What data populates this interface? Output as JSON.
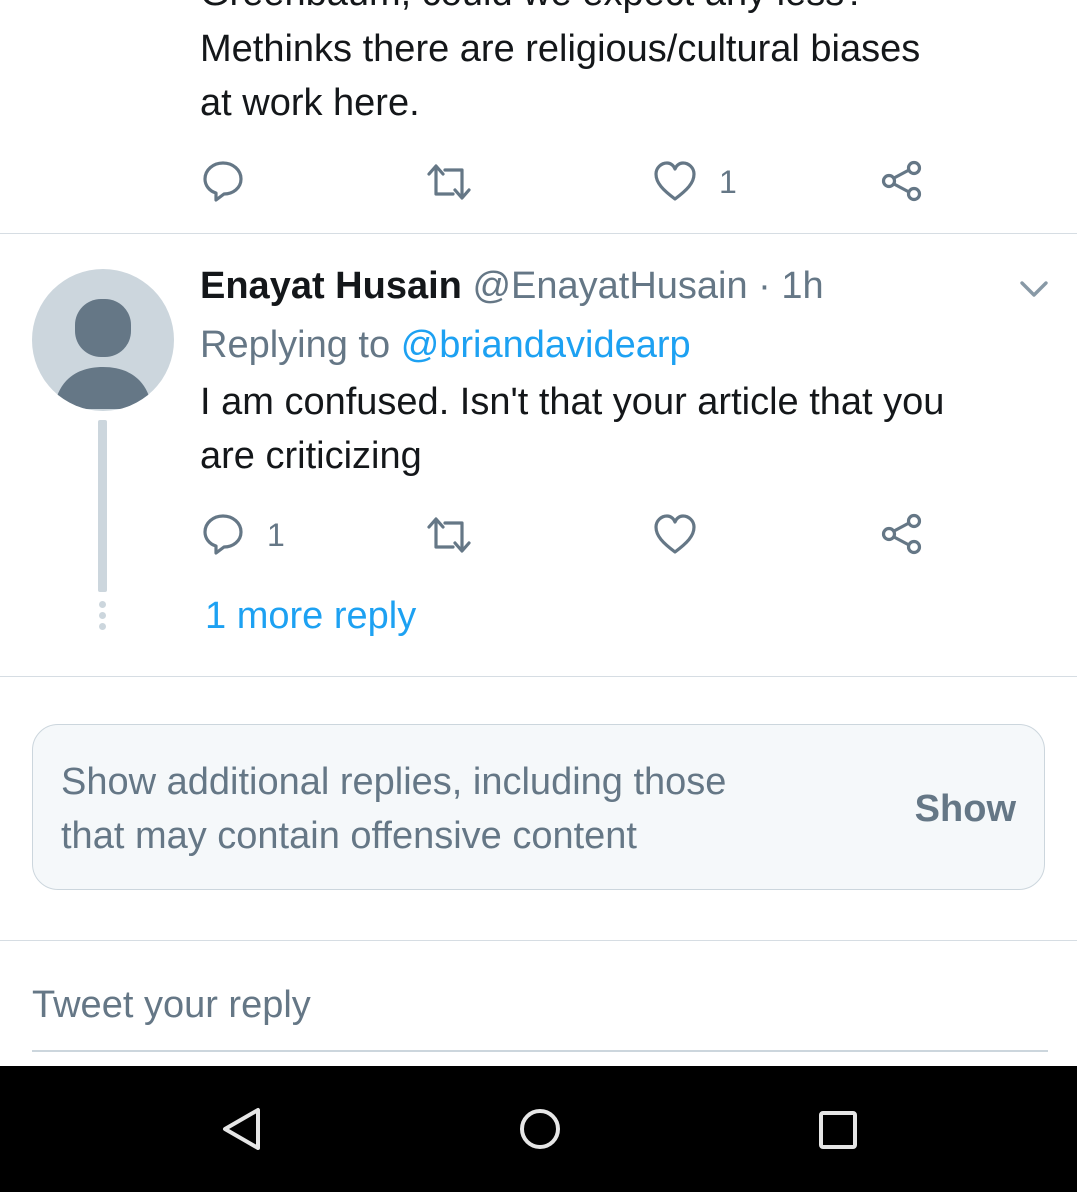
{
  "previous_tweet": {
    "text_line_partial": "Greenbaum, could we expect any less?",
    "text_lines": [
      "Methinks there are religious/cultural biases",
      "at work here."
    ],
    "actions": {
      "reply_count": "",
      "retweet_count": "",
      "like_count": "1"
    }
  },
  "reply_tweet": {
    "display_name": "Enayat Husain",
    "handle": "@EnayatHusain",
    "separator": "·",
    "time": "1h",
    "replying_prefix": "Replying to",
    "replying_handle": "@briandavidearp",
    "text_lines": [
      "I am confused. Isn't that your article that you",
      "are criticizing"
    ],
    "actions": {
      "reply_count": "1",
      "retweet_count": "",
      "like_count": ""
    },
    "more_replies": "1 more reply"
  },
  "show_more": {
    "text_lines": [
      "Show additional replies, including those",
      "that may contain offensive content"
    ],
    "button_label": "Show"
  },
  "compose": {
    "placeholder": "Tweet your reply"
  },
  "colors": {
    "accent": "#1da1f2",
    "secondary_text": "#657786",
    "divider": "#d6dde3"
  },
  "icons": [
    "reply-icon",
    "retweet-icon",
    "like-icon",
    "share-icon",
    "chevron-down-icon",
    "back-icon",
    "home-icon",
    "recents-icon"
  ]
}
